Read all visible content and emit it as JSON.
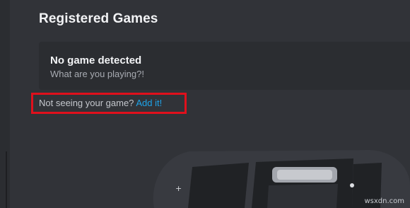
{
  "section": {
    "title": "Registered Games"
  },
  "game_card": {
    "title": "No game detected",
    "subtitle": "What are you playing?!"
  },
  "add_game": {
    "prompt": "Not seeing your game?",
    "link_label": "Add it!"
  },
  "illustration": {
    "plus_symbol": "+"
  },
  "watermark": "wsxdn.com",
  "colors": {
    "background": "#313338",
    "card": "#2b2d31",
    "link": "#1ea3e8",
    "highlight": "#e0101c"
  }
}
